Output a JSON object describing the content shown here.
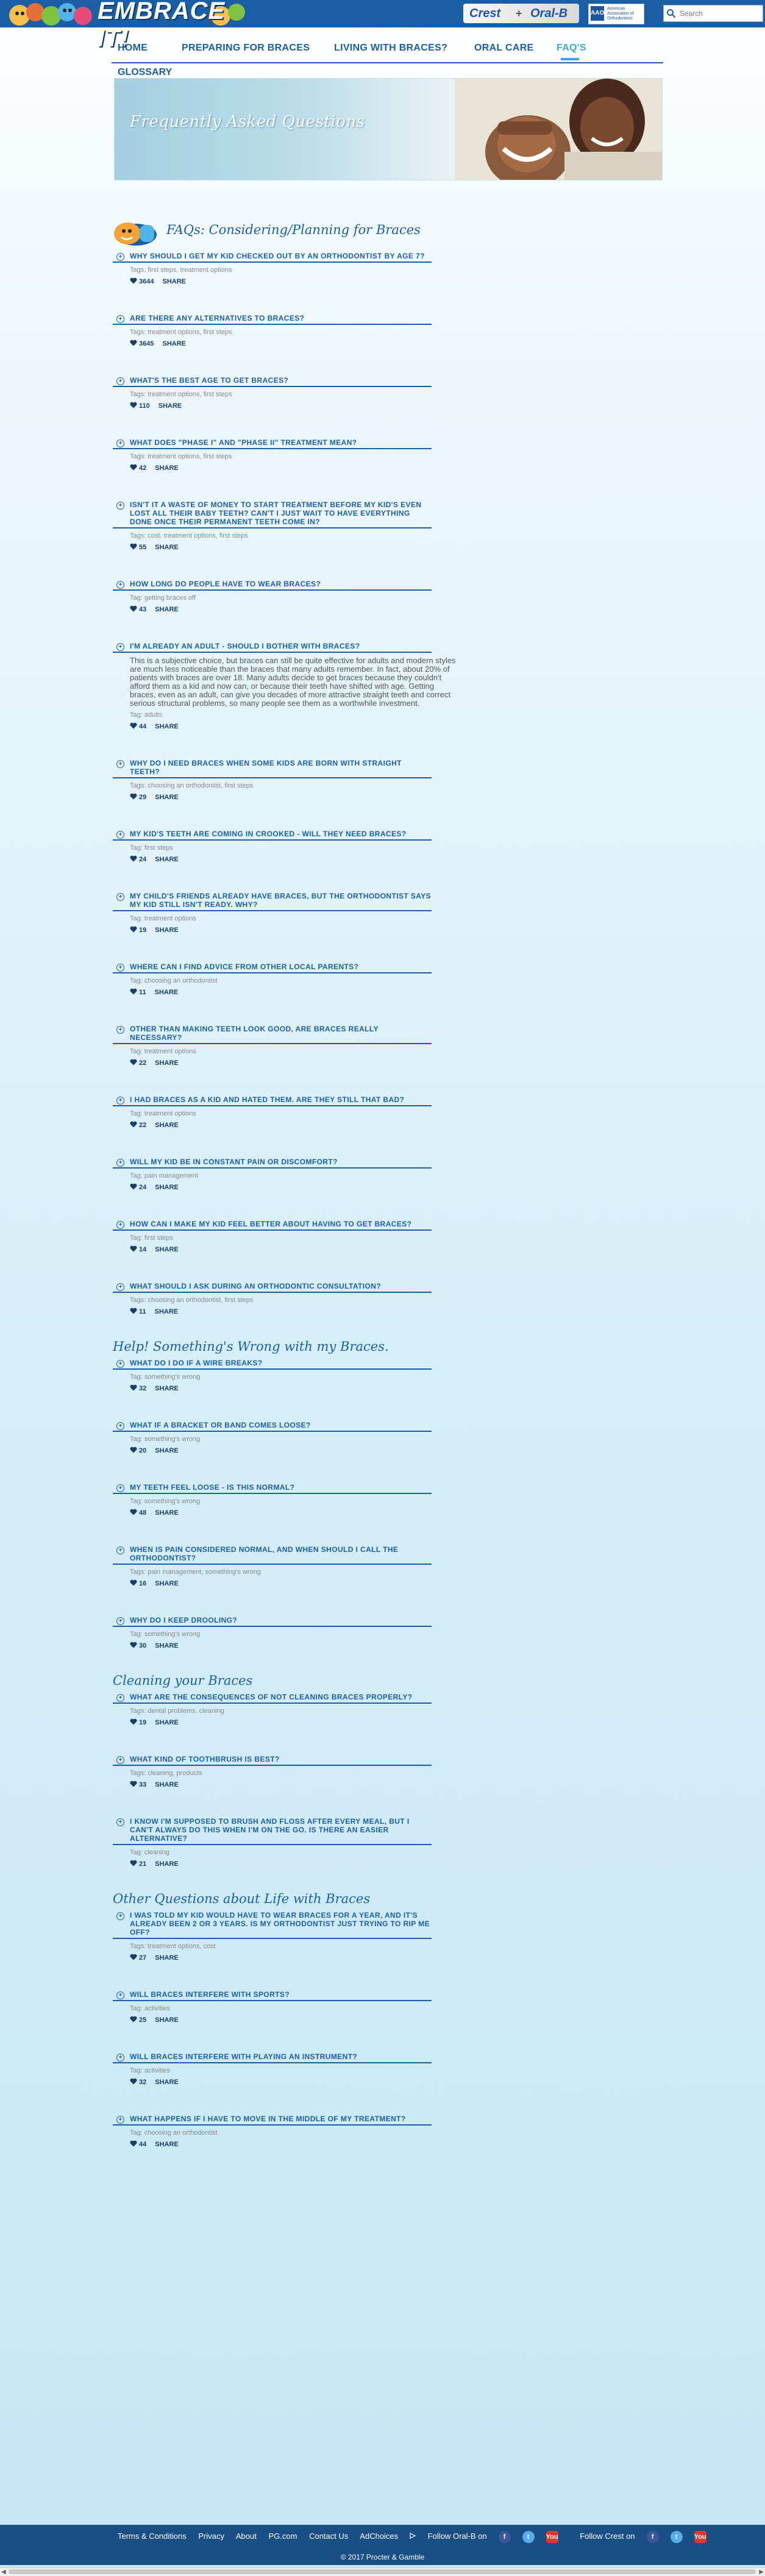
{
  "header": {
    "logo_text": "EMBRACE IT!",
    "brand_crest": "Crest",
    "brand_plus": "+",
    "brand_oralb": "Oral-B",
    "aao_badge": "AAO",
    "aao_text": "American Association of Orthodontists",
    "search_placeholder": "Search"
  },
  "nav": {
    "items": [
      "HOME",
      "PREPARING FOR BRACES",
      "LIVING WITH BRACES?",
      "ORAL CARE",
      "FAQ'S"
    ],
    "active": "FAQ'S",
    "glossary": "GLOSSARY"
  },
  "banner": {
    "title": "Frequently Asked Questions"
  },
  "sections": [
    {
      "title": "FAQs: Considering/Planning for Braces",
      "faqs": [
        {
          "q": "Why should I get my kid checked out by an orthodontist by age 7?",
          "tags": "Tags: first steps, treatment options",
          "likes": "3644",
          "share": "SHARE"
        },
        {
          "q": "Are there any alternatives to braces?",
          "tags": "Tags: treatment options, first steps",
          "likes": "3645",
          "share": "SHARE"
        },
        {
          "q": "What's the best age to get braces?",
          "tags": "Tags: treatment options, first steps",
          "likes": "110",
          "share": "SHARE"
        },
        {
          "q": "What does \"Phase I\" and \"Phase II\" treatment mean?",
          "tags": "Tags: treatment options, first steps",
          "likes": "42",
          "share": "SHARE"
        },
        {
          "q": "Isn't it a waste of money to start treatment before my kid's even lost all their baby teeth? Can't I just wait to have everything done once their permanent teeth come in?",
          "tags": "Tags: cost, treatment options, first steps",
          "likes": "55",
          "share": "SHARE"
        },
        {
          "q": "How long do people have to wear braces?",
          "tags": "Tag: getting braces off",
          "likes": "43",
          "share": "SHARE"
        },
        {
          "q": "I'm already an adult - should I bother with braces?",
          "answer": "This is a subjective choice, but braces can still be quite effective for adults and modern styles are much less noticeable than the braces that many adults remember. In fact, about 20% of patients with braces are over 18. Many adults decide to get braces because they couldn't afford them as a kid and now can, or because their teeth have shifted with age. Getting braces, even as an adult, can give you decades of more attractive straight teeth and correct serious structural problems, so many people see them as a worthwhile investment.",
          "tags": "Tag: adults",
          "likes": "44",
          "share": "SHARE"
        },
        {
          "q": "Why do I need braces when some kids are born with straight teeth?",
          "tags": "Tags: choosing an orthodontist, first steps",
          "likes": "29",
          "share": "SHARE"
        },
        {
          "q": "My kid's teeth are coming in crooked - will they need braces?",
          "tags": "Tag: first steps",
          "likes": "24",
          "share": "SHARE"
        },
        {
          "q": "My child's friends already have braces, but the orthodontist says my kid still isn't ready. Why?",
          "tags": "Tag: treatment options",
          "likes": "19",
          "share": "SHARE"
        },
        {
          "q": "Where can I find advice from other local parents?",
          "tags": "Tag: choosing an orthodontist",
          "likes": "11",
          "share": "SHARE"
        },
        {
          "q": "Other than making teeth look good, are braces really necessary?",
          "tags": "Tag: treatment options",
          "likes": "22",
          "share": "SHARE"
        },
        {
          "q": "I had braces as a kid and hated them. Are they still that bad?",
          "tags": "Tag: treatment options",
          "likes": "22",
          "share": "SHARE"
        },
        {
          "q": "Will my kid be in constant pain or discomfort?",
          "tags": "Tag: pain management",
          "likes": "24",
          "share": "SHARE"
        },
        {
          "q": "How can I make my kid feel better about having to get braces?",
          "tags": "Tag: first steps",
          "likes": "14",
          "share": "SHARE"
        },
        {
          "q": "What should I ask during an orthodontic consultation?",
          "tags": "Tags: choosing an orthodontist, first steps",
          "likes": "11",
          "share": "SHARE"
        }
      ]
    },
    {
      "title": "Help! Something's Wrong with my Braces.",
      "faqs": [
        {
          "q": "What do I do if a wire breaks?",
          "tags": "Tag: something's wrong",
          "likes": "32",
          "share": "SHARE"
        },
        {
          "q": "What if a bracket or band comes loose?",
          "tags": "Tag: something's wrong",
          "likes": "20",
          "share": "SHARE"
        },
        {
          "q": "My teeth feel loose - is this normal?",
          "tags": "Tag: something's wrong",
          "likes": "48",
          "share": "SHARE"
        },
        {
          "q": "When is pain considered normal, and when should I call the orthodontist?",
          "tags": "Tags: pain management, something's wrong",
          "likes": "16",
          "share": "SHARE"
        },
        {
          "q": "Why do I keep drooling?",
          "tags": "Tag: something's wrong",
          "likes": "30",
          "share": "SHARE"
        }
      ]
    },
    {
      "title": "Cleaning your Braces",
      "faqs": [
        {
          "q": "What are the consequences of not cleaning braces properly?",
          "tags": "Tags: dental problems, cleaning",
          "likes": "19",
          "share": "SHARE"
        },
        {
          "q": "What kind of toothbrush is best?",
          "tags": "Tags: cleaning, products",
          "likes": "33",
          "share": "SHARE"
        },
        {
          "q": "I know I'm supposed to brush and floss after every meal, but I can't always do this when I'm on the go. Is there an easier alternative?",
          "tags": "Tag: cleaning",
          "likes": "21",
          "share": "SHARE"
        }
      ]
    },
    {
      "title": "Other Questions about Life with Braces",
      "faqs": [
        {
          "q": "I was told my kid would have to wear braces for a year, and it's already been 2 or 3 years. Is my orthodontist just trying to rip me off?",
          "tags": "Tags: treatment options, cost",
          "likes": "27",
          "share": "SHARE"
        },
        {
          "q": "Will braces interfere with sports?",
          "tags": "Tag: activities",
          "likes": "25",
          "share": "SHARE"
        },
        {
          "q": "Will braces interfere with playing an instrument?",
          "tags": "Tag: activities",
          "likes": "32",
          "share": "SHARE"
        },
        {
          "q": "What happens if I have to move in the middle of my treatment?",
          "tags": "Tag: choosing an orthodontist",
          "likes": "44",
          "share": "SHARE"
        }
      ]
    }
  ],
  "footer": {
    "links": [
      "Terms & Conditions",
      "Privacy",
      "About",
      "PG.com",
      "Contact Us",
      "AdChoices"
    ],
    "follow_oralb": "Follow Oral-B on",
    "follow_crest": "Follow Crest on",
    "social": [
      "f",
      "t",
      "You"
    ],
    "copyright": "© 2017 Procter & Gamble"
  },
  "colors": {
    "nav_blue": "#1a5fa6",
    "active_blue": "#3ea7e8",
    "footer_blue": "#1a4f86"
  },
  "icons": [
    "search-icon",
    "heart-icon",
    "expand-icon",
    "tooth-mascot-icon",
    "adchoices-icon",
    "facebook-icon",
    "twitter-icon",
    "youtube-icon"
  ]
}
